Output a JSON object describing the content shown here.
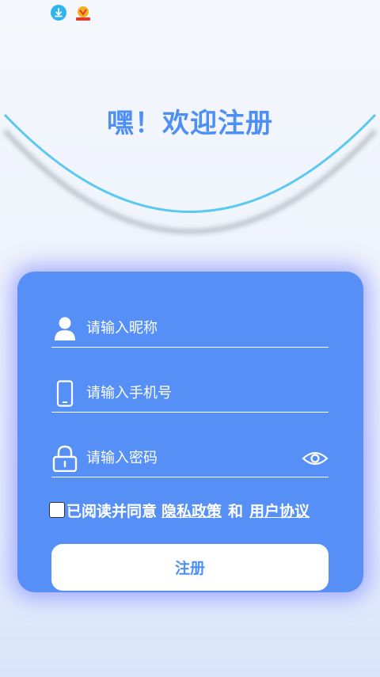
{
  "status_bar": {
    "icons": [
      "download-icon",
      "app-notification-icon"
    ]
  },
  "header": {
    "title": "嘿！欢迎注册"
  },
  "form": {
    "nickname": {
      "placeholder": "请输入昵称",
      "value": "",
      "icon": "user-icon"
    },
    "phone": {
      "placeholder": "请输入手机号",
      "value": "",
      "icon": "phone-icon"
    },
    "password": {
      "placeholder": "请输入密码",
      "value": "",
      "icon": "lock-icon",
      "toggle_icon": "eye-icon"
    },
    "agreement": {
      "checked": false,
      "prefix": "已阅读并同意",
      "privacy_link": "隐私政策",
      "and": "和",
      "user_link": "用户协议"
    },
    "submit_label": "注册"
  },
  "colors": {
    "accent": "#4e8ff3",
    "card": "#5690f7",
    "arc": "#5bc8f0",
    "status_download": "#2fb5ee"
  }
}
